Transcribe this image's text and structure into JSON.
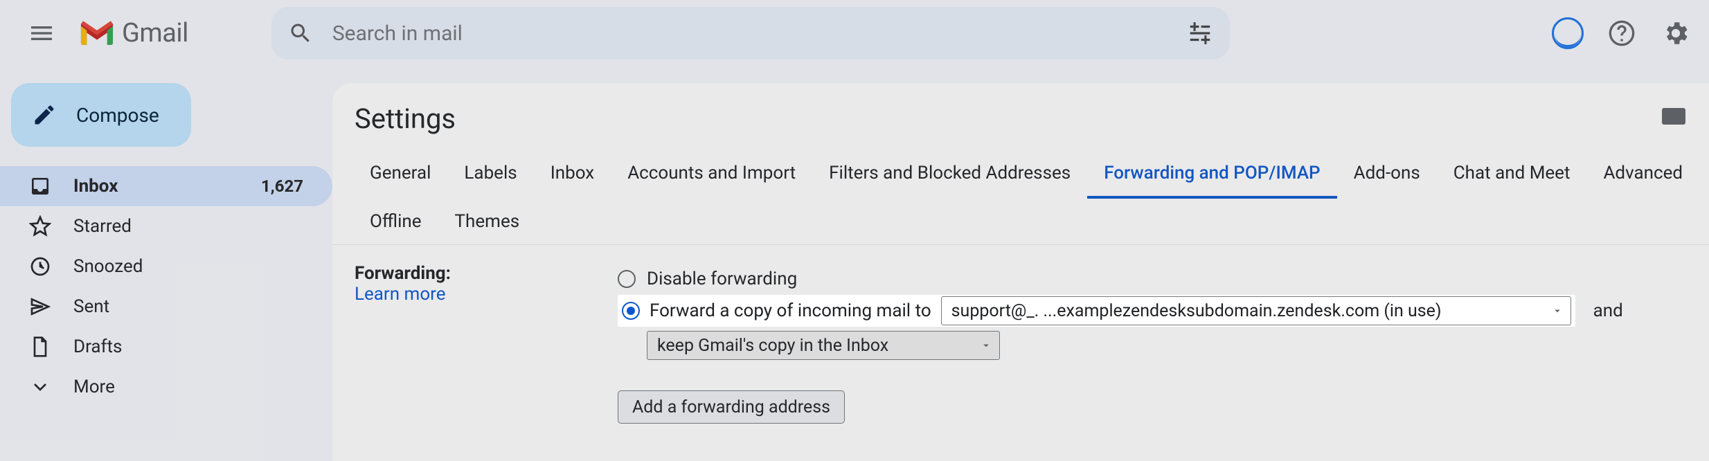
{
  "app": {
    "name": "Gmail"
  },
  "search": {
    "placeholder": "Search in mail"
  },
  "sidebar": {
    "compose": "Compose",
    "items": [
      {
        "label": "Inbox",
        "count": "1,627",
        "icon": "inbox"
      },
      {
        "label": "Starred",
        "icon": "star"
      },
      {
        "label": "Snoozed",
        "icon": "clock"
      },
      {
        "label": "Sent",
        "icon": "send"
      },
      {
        "label": "Drafts",
        "icon": "file"
      },
      {
        "label": "More",
        "icon": "chevron-down"
      }
    ]
  },
  "settings": {
    "heading": "Settings",
    "tabs": [
      "General",
      "Labels",
      "Inbox",
      "Accounts and Import",
      "Filters and Blocked Addresses",
      "Forwarding and POP/IMAP",
      "Add-ons",
      "Chat and Meet",
      "Advanced",
      "Offline",
      "Themes"
    ],
    "active_tab_index": 5,
    "forwarding": {
      "section_label": "Forwarding:",
      "learn_more": "Learn more",
      "disable_label": "Disable forwarding",
      "forward_label_prefix": "Forward a copy of incoming mail to",
      "forward_select_value": "support@_. ...examplezendesksubdomain.zendesk.com (in use)",
      "trailing_and": "and",
      "keep_copy_value": "keep Gmail's copy in the Inbox",
      "add_button": "Add a forwarding address"
    }
  }
}
